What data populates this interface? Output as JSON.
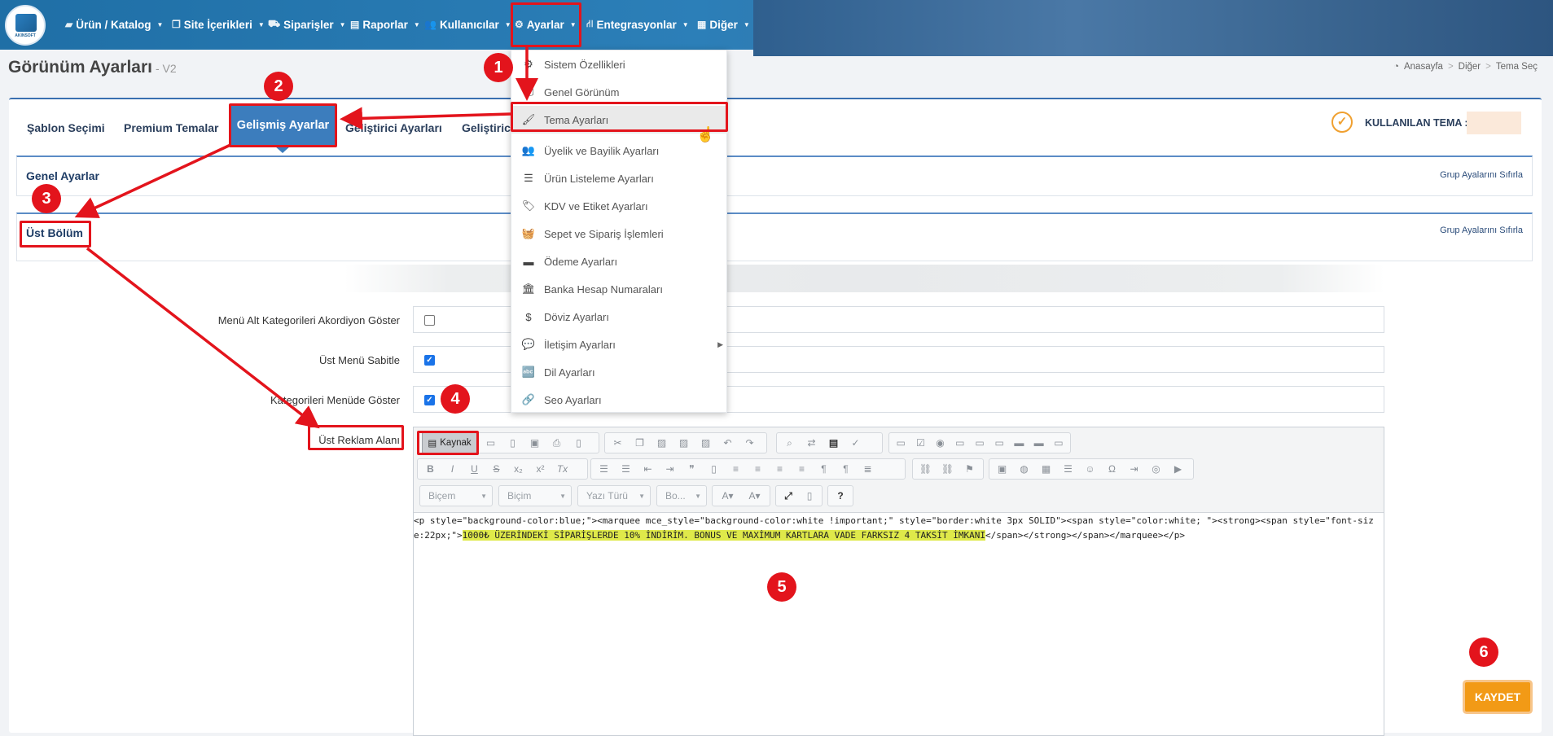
{
  "topnav": {
    "logo_text": "AKINSOFT",
    "items": [
      {
        "label": "Ürün / Katalog"
      },
      {
        "label": "Site İçerikleri"
      },
      {
        "label": "Siparişler"
      },
      {
        "label": "Raporlar"
      },
      {
        "label": "Kullanıcılar"
      },
      {
        "label": "Ayarlar"
      },
      {
        "label": "Entegrasyonlar"
      },
      {
        "label": "Diğer"
      }
    ]
  },
  "page": {
    "title": "Görünüm Ayarları",
    "version": "- V2",
    "breadcrumb": [
      "Anasayfa",
      "Diğer",
      "Tema Seç"
    ]
  },
  "tabs": {
    "items": [
      "Şablon Seçimi",
      "Premium Temalar",
      "Gelişmiş Ayarlar",
      "Geliştirici Ayarları",
      "Geliştiric"
    ],
    "active": "Gelişmiş Ayarlar"
  },
  "theme": {
    "label": "KULLANILAN TEMA :"
  },
  "sections": {
    "general": {
      "title": "Genel Ayarlar",
      "reset": "Grup Ayalarını Sıfırla"
    },
    "top": {
      "title": "Üst Bölüm",
      "reset": "Grup Ayalarını Sıfırla"
    }
  },
  "fields": [
    {
      "label": "Menü Alt Kategorileri Akordiyon Göster",
      "checked": false
    },
    {
      "label": "Üst Menü Sabitle",
      "checked": true
    },
    {
      "label": "Kategorileri Menüde Göster",
      "checked": true
    },
    {
      "label": "Üst Reklam Alanı"
    }
  ],
  "editor": {
    "source_button": "Kaynak",
    "combos": [
      "Biçem",
      "Biçim",
      "Yazı Türü",
      "Bo..."
    ],
    "code_before": "<p style=\"background-color:blue;\"><marquee mce_style=\"background-color:white !important;\" style=\"border:white 3px SOLID\"><span style=\"color:white; \"><strong><span style=\"font-size:22px;\">",
    "code_highlight": "1000₺ ÜZERİNDEKİ SİPARİŞLERDE 10% İNDİRİM. BONUS VE MAXİMUM KARTLARA VADE FARKSIZ 4 TAKSİT İMKANI",
    "code_after": "</span></strong></span></marquee></p>"
  },
  "settings_menu": {
    "items": [
      {
        "label": "Sistem Özellikleri",
        "icon": "gears-icon"
      },
      {
        "label": "Genel Görünüm",
        "icon": "monitor-icon"
      },
      {
        "label": "Tema Ayarları",
        "icon": "brush-icon"
      },
      {
        "label": "Üyelik ve Bayilik Ayarları",
        "icon": "users-icon"
      },
      {
        "label": "Ürün Listeleme Ayarları",
        "icon": "list-icon"
      },
      {
        "label": "KDV ve Etiket Ayarları",
        "icon": "tags-icon"
      },
      {
        "label": "Sepet ve Sipariş İşlemleri",
        "icon": "basket-icon"
      },
      {
        "label": "Ödeme Ayarları",
        "icon": "credit-card-icon"
      },
      {
        "label": "Banka Hesap Numaraları",
        "icon": "bank-icon"
      },
      {
        "label": "Döviz Ayarları",
        "icon": "dollar-icon"
      },
      {
        "label": "İletişim Ayarları",
        "icon": "comments-icon"
      },
      {
        "label": "Dil Ayarları",
        "icon": "language-icon"
      },
      {
        "label": "Seo Ayarları",
        "icon": "link-icon"
      }
    ],
    "hovered": "Tema Ayarları"
  },
  "annotations": [
    "1",
    "2",
    "3",
    "4",
    "5",
    "6"
  ],
  "save_button": "KAYDET",
  "colors": {
    "accent": "#3c7dbd",
    "annotation": "#e3141c",
    "save": "#f29a16",
    "highlight": "#dfe94a"
  }
}
